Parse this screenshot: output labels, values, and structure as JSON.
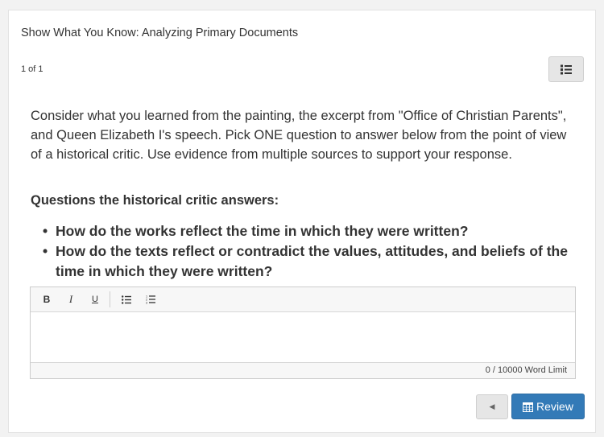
{
  "header": {
    "title": "Show What You Know: Analyzing Primary Documents",
    "counter": "1 of 1",
    "list_icon": "list-icon"
  },
  "content": {
    "prompt": "Consider what you learned from the painting, the excerpt from \"Office of Christian Parents\", and Queen Elizabeth I's speech. Pick ONE question to answer below from the point of view of a historical critic. Use evidence from multiple sources to support your response.",
    "questions_heading": "Questions the historical critic answers:",
    "questions": [
      "How do the works reflect the time in which they were written?",
      "How do the texts reflect or contradict the values, attitudes, and beliefs of the time in which they were written?"
    ]
  },
  "editor": {
    "toolbar": {
      "bold": "B",
      "italic": "I",
      "underline": "U",
      "bullet_list_icon": "bullet-list-icon",
      "numbered_list_icon": "numbered-list-icon"
    },
    "value": "",
    "word_count": "0",
    "word_limit": "/ 10000 Word Limit"
  },
  "footer": {
    "back_icon": "triangle-left-icon",
    "back_glyph": "◀",
    "review_label": "Review",
    "review_icon": "calendar-icon"
  },
  "colors": {
    "primary": "#337ab7",
    "background": "#f2f2f2"
  }
}
